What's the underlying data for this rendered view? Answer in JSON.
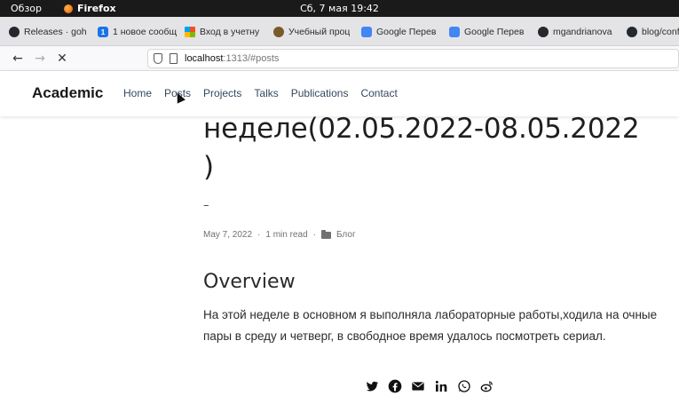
{
  "system": {
    "activities": "Обзор",
    "app": "Firefox",
    "clock": "Сб, 7 мая  19:42"
  },
  "tabs": [
    {
      "icon": "github-icon",
      "label": "Releases · goh"
    },
    {
      "icon": "notification-icon",
      "label": "1 новое сообщ"
    },
    {
      "icon": "microsoft-icon",
      "label": "Вход в учетну"
    },
    {
      "icon": "owl-icon",
      "label": "Учебный проц"
    },
    {
      "icon": "google-translate-icon",
      "label": "Google Перев"
    },
    {
      "icon": "google-translate-icon",
      "label": "Google Перев"
    },
    {
      "icon": "github-icon",
      "label": "mgandrianova"
    },
    {
      "icon": "github-icon",
      "label": "blog/conf"
    }
  ],
  "nav": {
    "url_host": "localhost",
    "url_path": ":1313/#posts"
  },
  "site": {
    "brand": "Academic",
    "menu": [
      "Home",
      "Posts",
      "Projects",
      "Talks",
      "Publications",
      "Contact"
    ]
  },
  "post": {
    "title_line1": "неделе(02.05.2022-08.05.2022",
    "title_line2": ")",
    "dash": "–",
    "date": "May 7, 2022",
    "sep": "·",
    "read_time": "1 min read",
    "category": "Блог",
    "section_heading": "Overview",
    "paragraph": "На этой неделе в основном я выполняла лабораторные работы,ходила на очные пары в среду и четверг, в свободное время удалось посмотреть сериал."
  },
  "share_icons": [
    "twitter-icon",
    "facebook-icon",
    "email-icon",
    "linkedin-icon",
    "whatsapp-icon",
    "weibo-icon"
  ]
}
